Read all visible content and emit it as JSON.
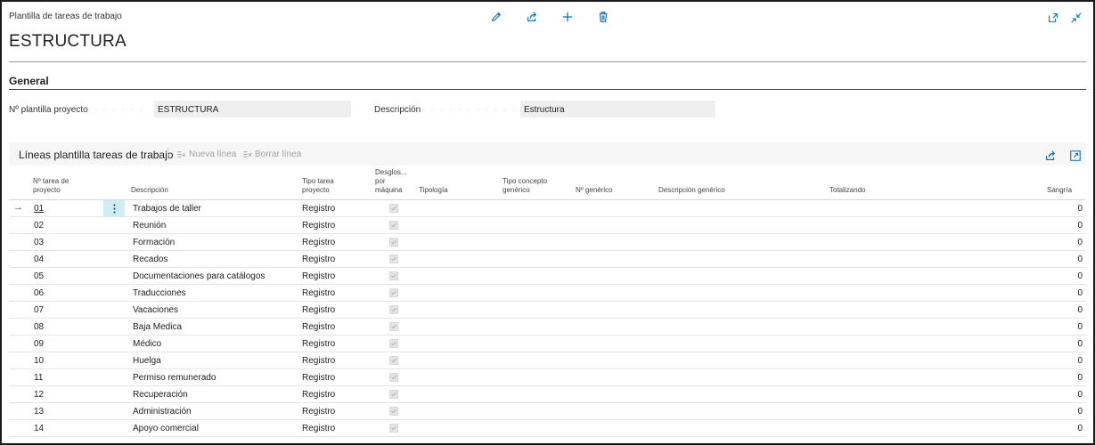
{
  "header": {
    "breadcrumb": "Plantilla de tareas de trabajo",
    "title": "ESTRUCTURA",
    "actions": [
      "edit-icon",
      "share-icon",
      "add-icon",
      "delete-icon"
    ],
    "corner_actions": [
      "open-new-window-icon",
      "collapse-icon"
    ]
  },
  "general": {
    "section_title": "General",
    "fields": [
      {
        "label": "Nº plantilla proyecto",
        "value": "ESTRUCTURA"
      },
      {
        "label": "Descripción",
        "value": "Estructura"
      }
    ]
  },
  "lines": {
    "title": "Líneas plantilla tareas de trabajo",
    "new_line_label": "Nueva línea",
    "delete_line_label": "Borrar línea",
    "columns": {
      "task_no": "Nº tarea de proyecto",
      "description": "Descripción",
      "task_type": "Tipo tarea proyecto",
      "breakdown": "Desglos... por máquina",
      "typology": "Tipología",
      "generic_concept_type": "Tipo concepto genérico",
      "generic_no": "Nº genérico",
      "generic_description": "Descripción genérico",
      "totaling": "Totalizando",
      "indentation": "Sangría"
    },
    "rows": [
      {
        "no": "01",
        "desc": "Trabajos de taller",
        "type": "Registro",
        "indent": "0"
      },
      {
        "no": "02",
        "desc": "Reunión",
        "type": "Registro",
        "indent": "0"
      },
      {
        "no": "03",
        "desc": "Formación",
        "type": "Registro",
        "indent": "0"
      },
      {
        "no": "04",
        "desc": "Recados",
        "type": "Registro",
        "indent": "0"
      },
      {
        "no": "05",
        "desc": "Documentaciones para catálogos",
        "type": "Registro",
        "indent": "0"
      },
      {
        "no": "06",
        "desc": "Traducciones",
        "type": "Registro",
        "indent": "0"
      },
      {
        "no": "07",
        "desc": "Vacaciones",
        "type": "Registro",
        "indent": "0"
      },
      {
        "no": "08",
        "desc": "Baja Medica",
        "type": "Registro",
        "indent": "0"
      },
      {
        "no": "09",
        "desc": "Médico",
        "type": "Registro",
        "indent": "0"
      },
      {
        "no": "10",
        "desc": "Huelga",
        "type": "Registro",
        "indent": "0"
      },
      {
        "no": "11",
        "desc": "Permiso remunerado",
        "type": "Registro",
        "indent": "0"
      },
      {
        "no": "12",
        "desc": "Recuperación",
        "type": "Registro",
        "indent": "0"
      },
      {
        "no": "13",
        "desc": "Administración",
        "type": "Registro",
        "indent": "0"
      },
      {
        "no": "14",
        "desc": "Apoyo comercial",
        "type": "Registro",
        "indent": "0"
      }
    ]
  },
  "colors": {
    "accent": "#0078d4",
    "selected_cell": "#cdeef2"
  }
}
